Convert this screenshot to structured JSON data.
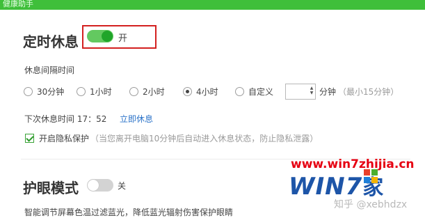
{
  "window": {
    "title": "健康助手"
  },
  "rest_timer": {
    "title": "定时休息",
    "toggle_label": "开",
    "toggle_on": true,
    "interval_label": "休息间隔时间",
    "options": [
      "30分钟",
      "1小时",
      "2小时",
      "4小时",
      "自定义"
    ],
    "selected_option": "4小时",
    "custom_value": "",
    "unit_label": "分钟",
    "min_hint": "（最小15分钟）",
    "next_rest_label": "下次休息时间 17：52",
    "rest_now_link": "立即休息",
    "privacy_label": "开启隐私保护",
    "privacy_checked": true,
    "privacy_hint": "（当您离开电脑10分钟后自动进入休息状态，防止隐私泄露）"
  },
  "eye_mode": {
    "title": "护眼模式",
    "toggle_label": "关",
    "toggle_on": false,
    "desc_partial": "智能调节屏幕色温过滤蓝光，降低蓝光辐射伤害保护眼睛"
  },
  "watermark": {
    "site": "www.win7zhijia.cn",
    "logo_text": "WIN7",
    "logo_suffix": "家",
    "zhihu": "知乎 @xebhdzx"
  },
  "colors": {
    "accent_green": "#3fbf3a",
    "link_blue": "#2d74c9",
    "highlight_red": "#d3201f"
  },
  "icons": [
    "spinner-arrows-icon",
    "checkmark-icon",
    "windows-logo-icon"
  ]
}
